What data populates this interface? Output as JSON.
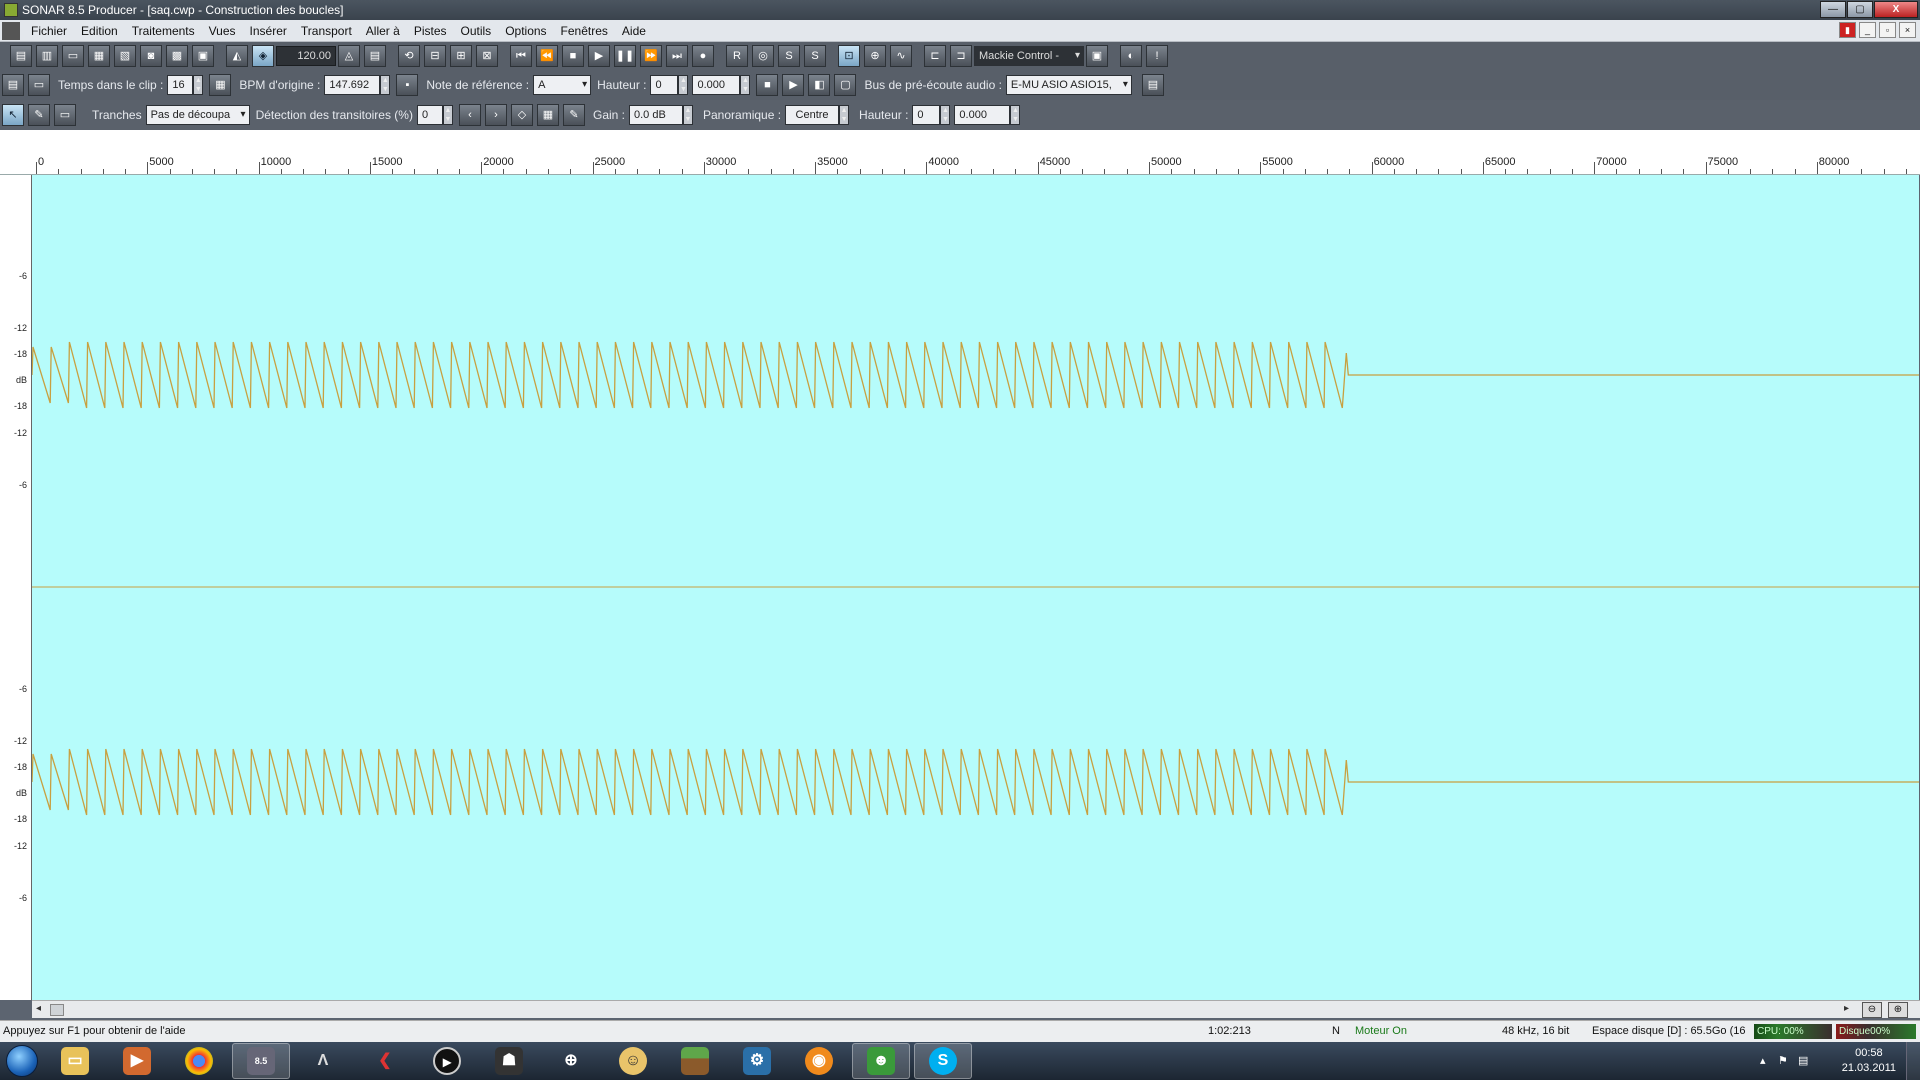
{
  "window": {
    "title": "SONAR 8.5 Producer - [saq.cwp - Construction des boucles]",
    "min_label": "—",
    "max_label": "▢",
    "close_label": "X"
  },
  "menu": {
    "items": [
      "Fichier",
      "Edition",
      "Traitements",
      "Vues",
      "Insérer",
      "Transport",
      "Aller à",
      "Pistes",
      "Outils",
      "Options",
      "Fenêtres",
      "Aide"
    ]
  },
  "toolbar1": {
    "tempo": "120.00",
    "control_surface": "Mackie Control -",
    "transport_labels": {
      "rec": "R",
      "s1": "S",
      "s2": "S"
    }
  },
  "toolbar2": {
    "temps_label": "Temps dans le clip :",
    "temps_value": "16",
    "bpm_label": "BPM d'origine :",
    "bpm_value": "147.692",
    "note_label": "Note de référence :",
    "note_value": "A",
    "hauteur_label": "Hauteur :",
    "hauteur_value": "0",
    "hauteur_fine": "0.000",
    "bus_label": "Bus de pré-écoute audio :",
    "bus_value": "E-MU ASIO ASIO15,"
  },
  "toolbar3": {
    "tranches_label": "Tranches",
    "tranches_value": "Pas de découpa",
    "detection_label": "Détection des transitoires (%)",
    "detection_value": "0",
    "gain_label": "Gain :",
    "gain_value": "0.0 dB",
    "pan_label": "Panoramique :",
    "pan_value": "Centre",
    "hauteur_label": "Hauteur :",
    "hauteur_value": "0",
    "hauteur_fine": "0.000"
  },
  "ruler": {
    "labels": [
      "0",
      "5000",
      "10000",
      "15000",
      "20000",
      "25000",
      "30000",
      "35000",
      "40000",
      "45000",
      "50000",
      "55000",
      "60000",
      "65000",
      "70000",
      "75000",
      "80000"
    ]
  },
  "db_scale": {
    "top_channel": [
      "-6",
      "-12",
      "-18",
      "dB",
      "-18",
      "-12",
      "-6"
    ],
    "bottom_channel": [
      "-6",
      "-12",
      "-18",
      "dB",
      "-18",
      "-12",
      "-6"
    ]
  },
  "waveform": {
    "color": "#c8a040",
    "background": "#b6fcfb",
    "cycles": 72,
    "end_sample_fraction": 0.8
  },
  "statusbar": {
    "help": "Appuyez sur F1 pour obtenir de l'aide",
    "position": "1:02:213",
    "mode": "N",
    "engine": "Moteur On",
    "format": "48 kHz, 16 bit",
    "disk": "Espace disque [D] : 65.5Go (16",
    "cpu": "CPU: 00%",
    "disk_meter": "Disque00%"
  },
  "taskbar": {
    "apps": [
      "explorer-icon",
      "media-player-icon",
      "chrome-icon",
      "sonar-icon",
      "assassins-creed-icon",
      "flashget-icon",
      "media-center-icon",
      "game-icon",
      "crosshair-icon",
      "fallout-icon",
      "minecraft-icon",
      "steam-icon",
      "radio-icon",
      "messenger-icon",
      "skype-icon"
    ],
    "time": "00:58",
    "date": "21.03.2011"
  }
}
